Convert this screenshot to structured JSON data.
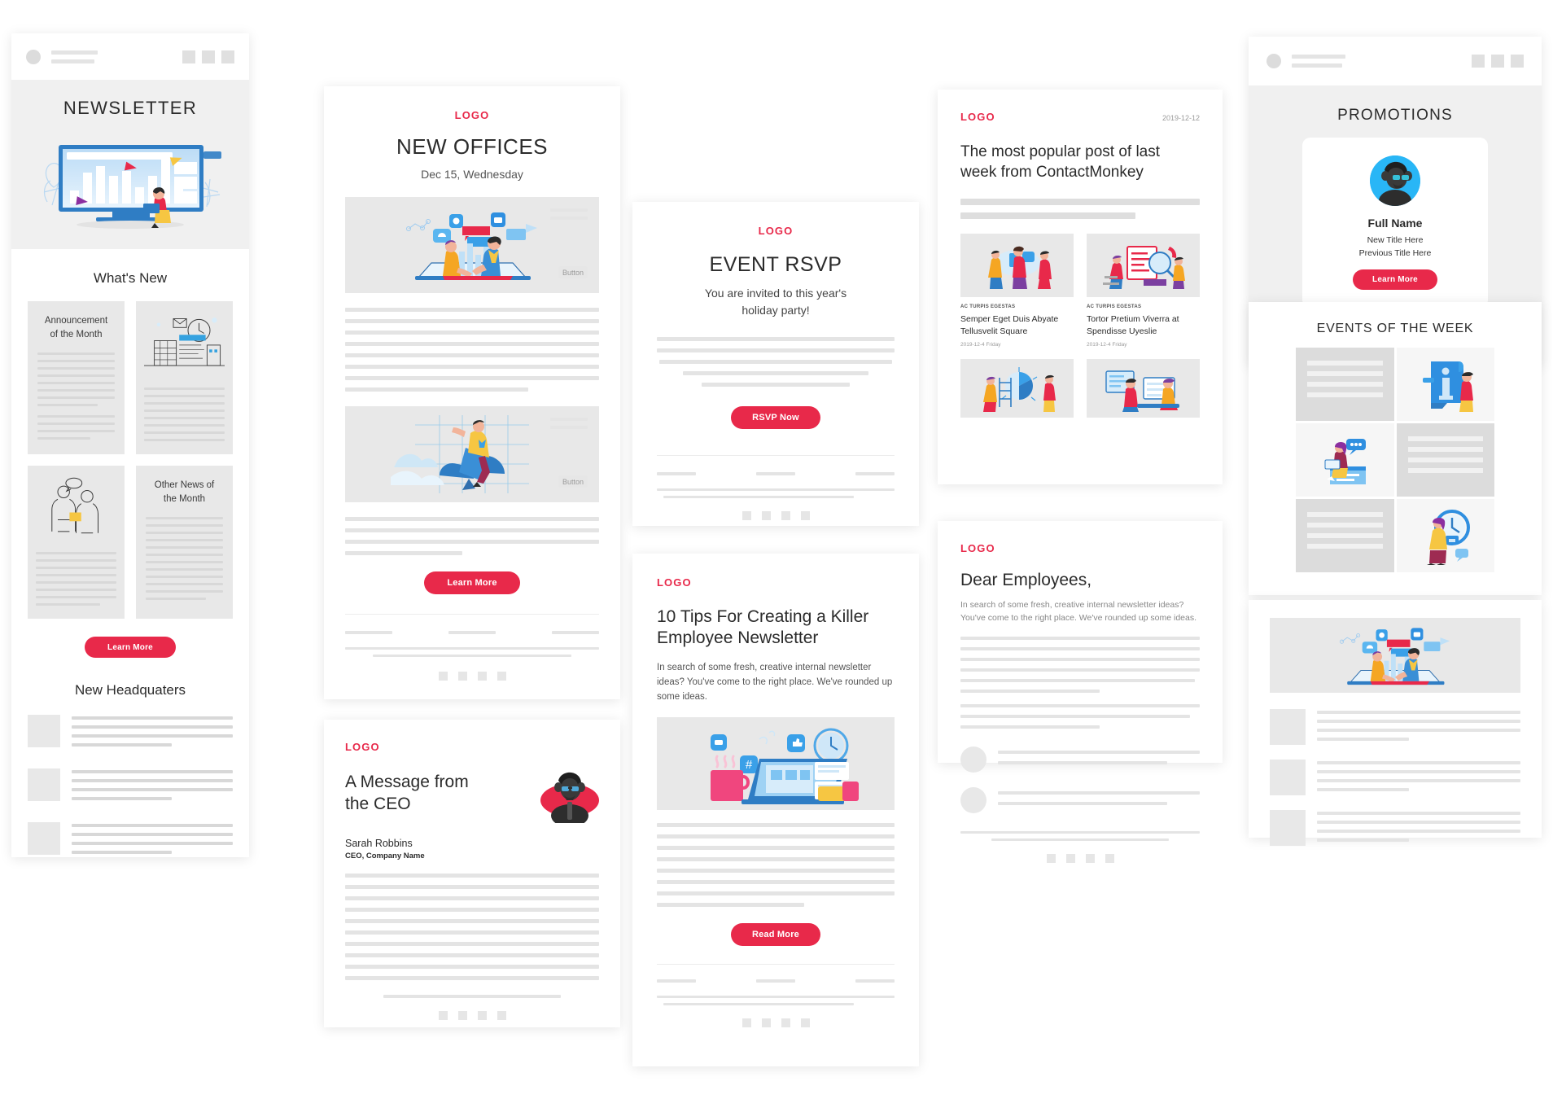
{
  "meta": {
    "accent": "#e8294a",
    "page_bg": "#ffffff",
    "panel_bg": "#f0f0f0"
  },
  "card_newsletter": {
    "name": "newsletter-email-template",
    "banner_title": "NEWSLETTER",
    "whats_new_title": "What's New",
    "tiles": [
      {
        "title": "Announcement\nof the Month",
        "type": "text"
      },
      {
        "title": "",
        "type": "image"
      },
      {
        "title": "",
        "type": "image"
      },
      {
        "title": "Other News of\nthe Month",
        "type": "text"
      }
    ],
    "learn_more_label": "Learn More",
    "headquarters_title": "New Headquaters"
  },
  "card_new_offices": {
    "name": "new-offices-email-template",
    "logo": "LOGO",
    "title": "NEW OFFICES",
    "date": "Dec 15, Wednesday",
    "image_button_label": "Button",
    "learn_more_label": "Learn More"
  },
  "card_ceo": {
    "name": "ceo-message-email-template",
    "logo": "LOGO",
    "title": "A Message from\nthe CEO",
    "author_name": "Sarah Robbins",
    "author_role": "CEO, Company Name"
  },
  "card_rsvp": {
    "name": "event-rsvp-email-template",
    "logo": "LOGO",
    "title": "EVENT RSVP",
    "subtitle": "You are invited to this year's\nholiday party!",
    "button_label": "RSVP Now"
  },
  "card_tips": {
    "name": "ten-tips-email-template",
    "logo": "LOGO",
    "title": "10 Tips For Creating a Killer Employee Newsletter",
    "body": "In search of some fresh, creative internal newsletter ideas? You've come to the right place. We've rounded up some ideas.",
    "button_label": "Read More"
  },
  "card_popular_post": {
    "name": "popular-post-email-template",
    "logo": "LOGO",
    "date": "2019-12-12",
    "title": "The most popular post of last week from ContactMonkey",
    "posts": [
      {
        "kicker": "AC TURPIS EGESTAS",
        "headline": "Semper Eget Duis Abyate Tellusvelit Square",
        "date": "2019-12-4 Friday"
      },
      {
        "kicker": "AC TURPIS EGESTAS",
        "headline": "Tortor Pretium Viverra at Spendisse Uyeslie",
        "date": "2019-12-4 Friday"
      }
    ]
  },
  "card_dear_employees": {
    "name": "dear-employees-email-template",
    "logo": "LOGO",
    "title": "Dear Employees,",
    "body": "In search of some fresh, creative internal newsletter ideas? You've come to the right place. We've rounded up some ideas."
  },
  "card_promotions": {
    "name": "promotions-email-template",
    "section_title": "PROMOTIONS",
    "person": {
      "full_name": "Full Name",
      "new_title": "New Title Here",
      "previous_title": "Previous Title Here"
    },
    "learn_more_label": "Learn More",
    "events_title": "EVENTS OF THE WEEK"
  }
}
